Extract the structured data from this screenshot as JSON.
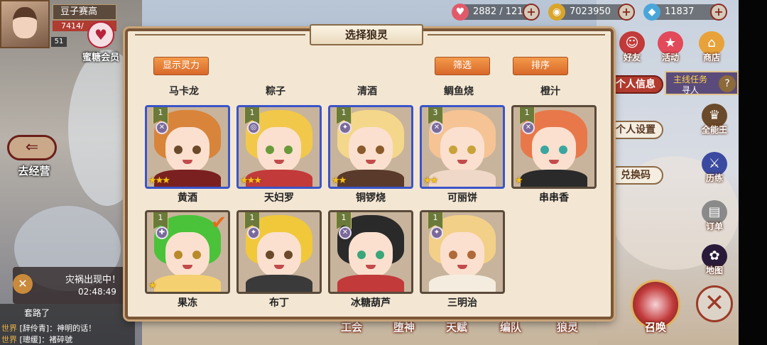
{
  "top": {
    "player_name": "豆子赛高",
    "exp": "7414/",
    "level": "51",
    "vip_label": "蜜糖会员",
    "stamina": "2882 / 121",
    "gold": "7023950",
    "diamonds": "11837"
  },
  "left": {
    "go_camp": "去经营",
    "disaster_title": "灾祸出现中！",
    "disaster_timer": "02:48:49",
    "chat_line0": "套路了",
    "chat": [
      {
        "channel": "世界",
        "text": "[辞伶青]：神明的话！"
      },
      {
        "channel": "世界",
        "text": "[璁缓]：褚碎號"
      }
    ]
  },
  "right": {
    "friends": "好友",
    "events": "活动",
    "shop": "商店",
    "info_tabs": [
      "个人信息",
      "个人设置",
      "兑换码"
    ],
    "quest_a": "主线任务",
    "quest_b": "寻人",
    "quest_q": "?",
    "all_star": "全能王",
    "training": "历练",
    "orders": "订单",
    "map": "地图"
  },
  "bottom_menu": [
    "工会",
    "堕神",
    "天赋",
    "编队",
    "狼灵",
    "召唤"
  ],
  "panel": {
    "title": "选择狼灵",
    "btn_show_power": "显示灵力",
    "btn_filter": "筛选",
    "btn_sort": "排序",
    "top_names": [
      "马卡龙",
      "粽子",
      "清酒",
      "鲷鱼烧",
      "橙汁"
    ],
    "cards": [
      {
        "name": "黄酒",
        "level": "1",
        "stars": "★★★",
        "element": "✕",
        "hair": "#d8843a",
        "eye": "#6a4a2a",
        "body": "#7a2020",
        "blue": true
      },
      {
        "name": "天妇罗",
        "level": "1",
        "stars": "★★★",
        "element": "◎",
        "hair": "#f1c84a",
        "eye": "#6a9a3a",
        "body": "#c23a3a",
        "blue": true
      },
      {
        "name": "铜锣烧",
        "level": "1",
        "stars": "★★",
        "element": "✦",
        "hair": "#f4d78a",
        "eye": "#8a5a2a",
        "body": "#5a3a2a",
        "blue": true
      },
      {
        "name": "可丽饼",
        "level": "3",
        "stars": "★★",
        "element": "✕",
        "hair": "#f5c394",
        "eye": "#c9a33a",
        "body": "#f0d8c8",
        "blue": true
      },
      {
        "name": "串串香",
        "level": "1",
        "stars": "★",
        "element": "✕",
        "hair": "#e8784a",
        "eye": "#3aa6a0",
        "body": "#2a2a2a",
        "blue": false
      },
      {
        "name": "果冻",
        "level": "1",
        "stars": "★",
        "element": "✚",
        "hair": "#4ac23a",
        "eye": "#b88a2a",
        "body": "#f5d070",
        "blue": false,
        "checked": "✔"
      },
      {
        "name": "布丁",
        "level": "1",
        "stars": "",
        "element": "✦",
        "hair": "#f0c83a",
        "eye": "#6a4a2a",
        "body": "#3a3a3a",
        "blue": false
      },
      {
        "name": "冰糖葫芦",
        "level": "1",
        "stars": "",
        "element": "✕",
        "hair": "#2a2a2a",
        "eye": "#3aa67a",
        "body": "#c23a3a",
        "blue": false
      },
      {
        "name": "三明治",
        "level": "1",
        "stars": "",
        "element": "✦",
        "hair": "#f3d088",
        "eye": "#b06a3a",
        "body": "#f5ece0",
        "blue": false
      }
    ]
  }
}
